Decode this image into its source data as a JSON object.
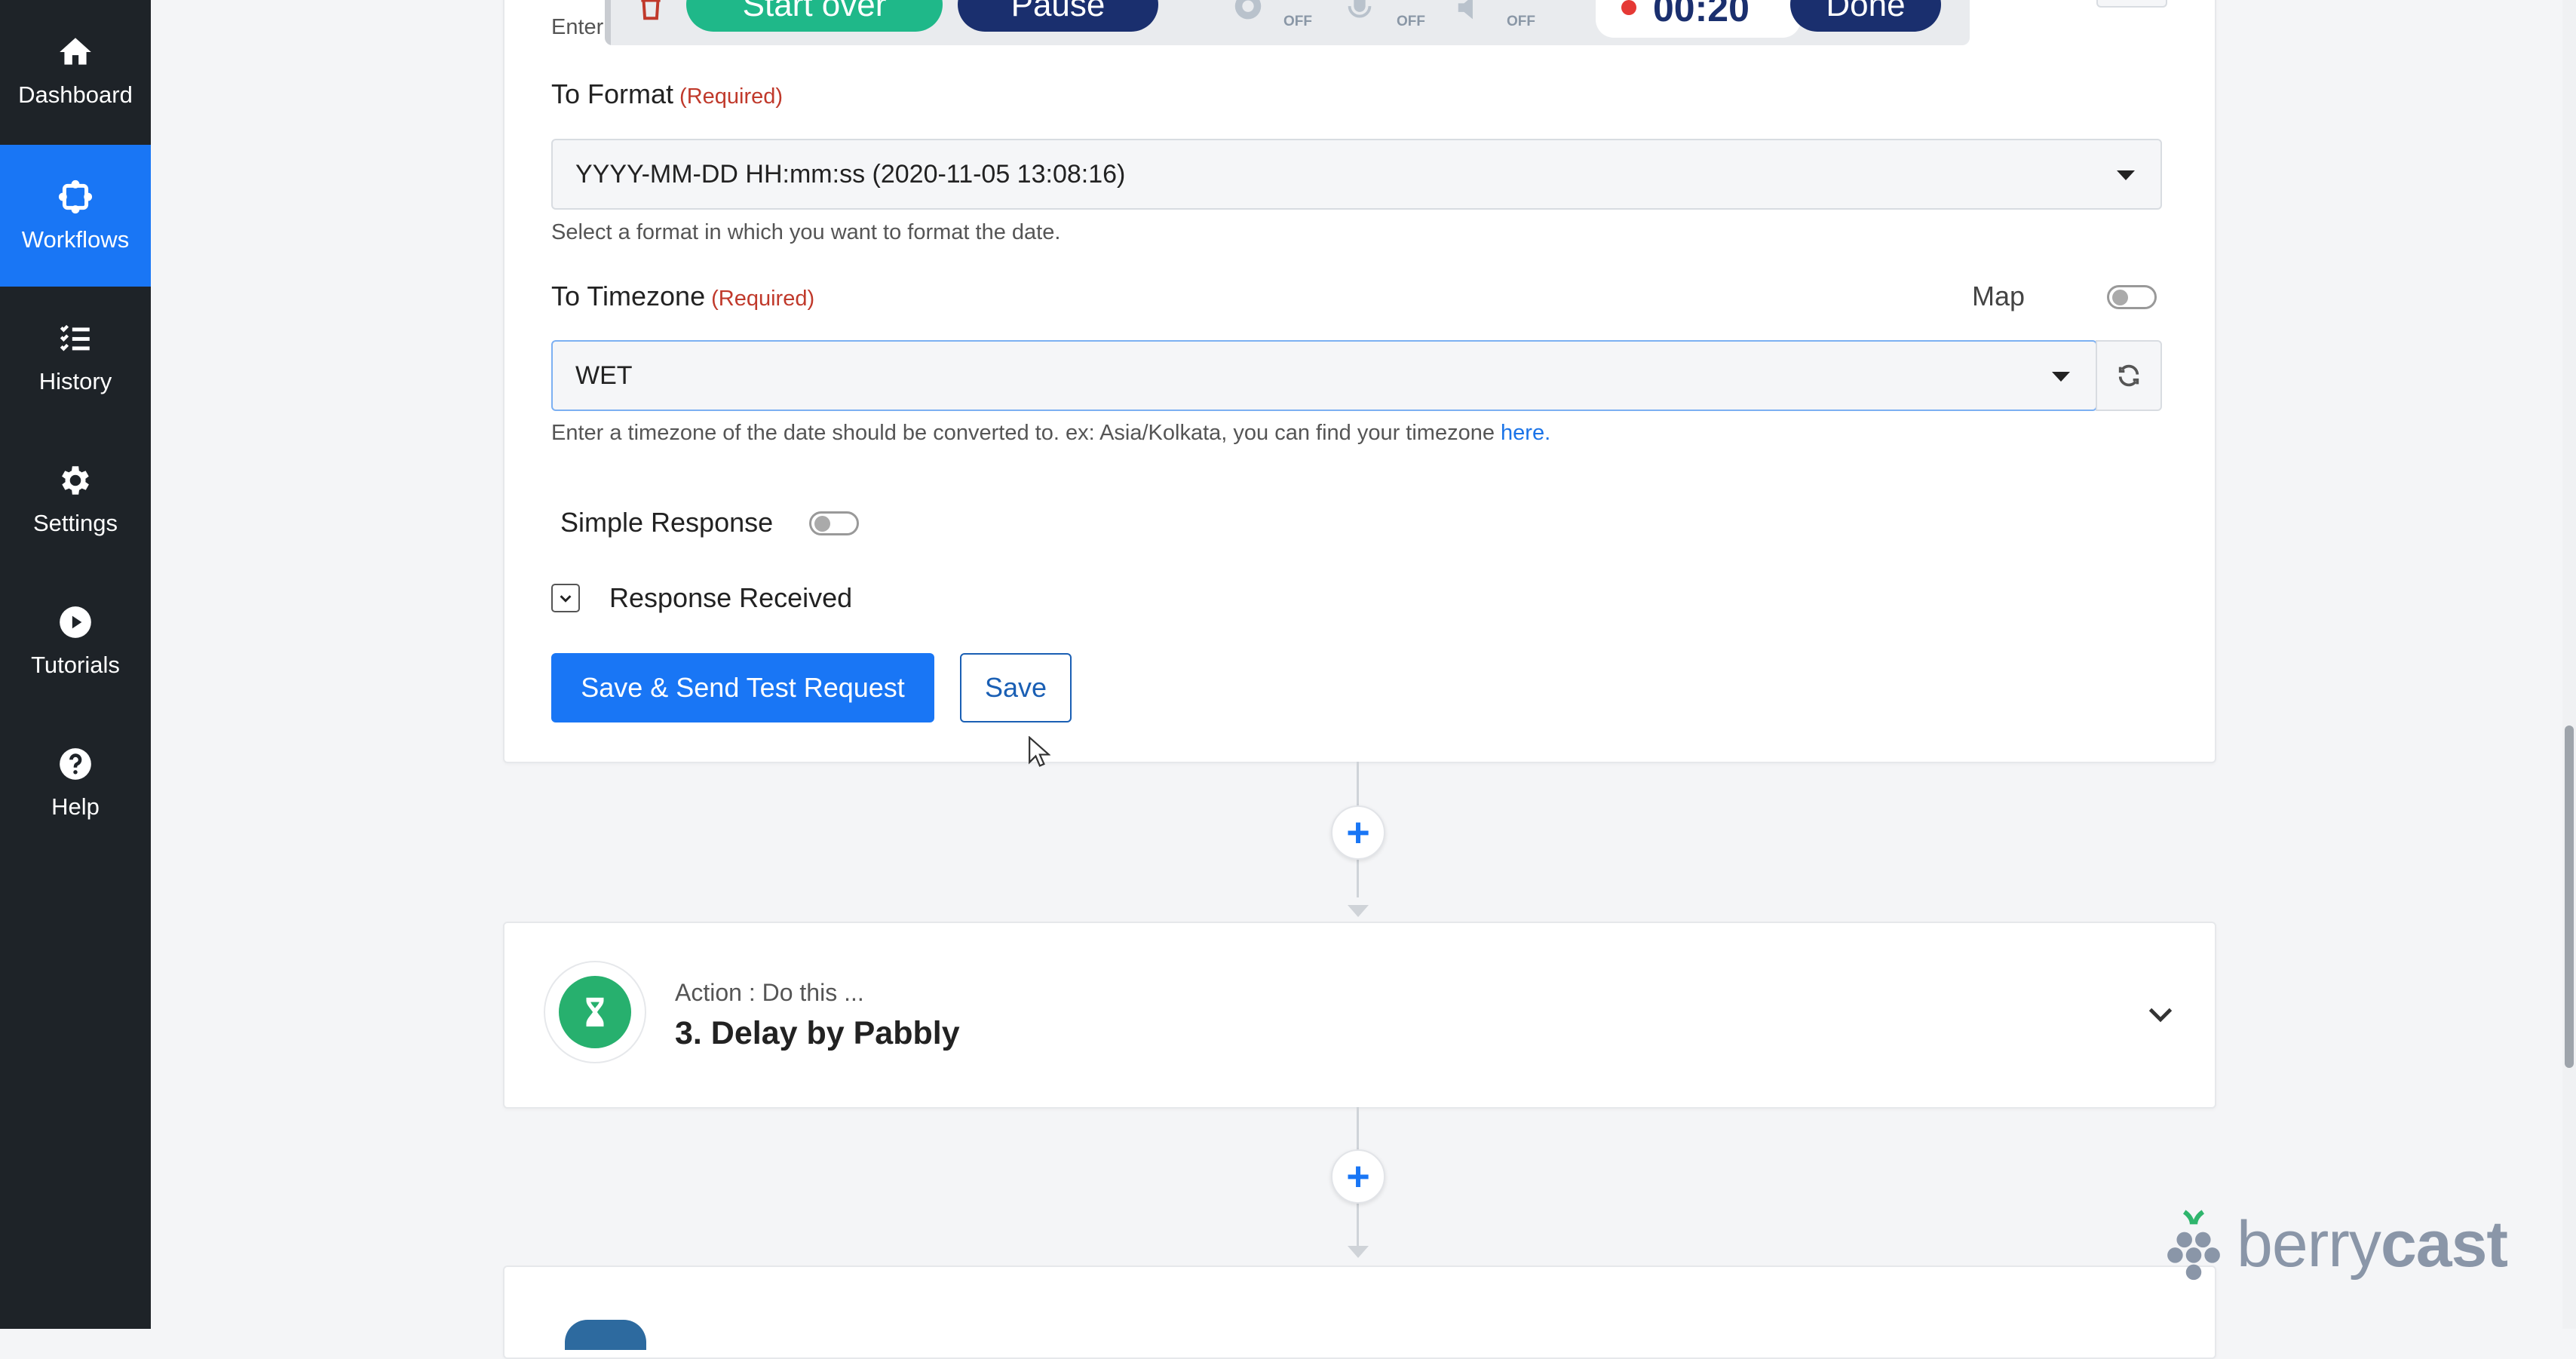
{
  "sidebar": {
    "items": [
      {
        "label": "Dashboard",
        "icon": "home-icon"
      },
      {
        "label": "Workflows",
        "icon": "workflow-icon",
        "active": true
      },
      {
        "label": "History",
        "icon": "list-check-icon"
      },
      {
        "label": "Settings",
        "icon": "gear-icon"
      },
      {
        "label": "Tutorials",
        "icon": "play-circle-icon"
      },
      {
        "label": "Help",
        "icon": "help-circle-icon"
      }
    ]
  },
  "recorder": {
    "start_over": "Start over",
    "pause": "Pause",
    "off": "OFF",
    "timer": "00:20",
    "done": "Done"
  },
  "form": {
    "top_hint": "Enter",
    "to_format": {
      "label": "To Format",
      "required": "(Required)",
      "value": "YYYY-MM-DD HH:mm:ss (2020-11-05 13:08:16)",
      "help": "Select a format in which you want to format the date."
    },
    "to_timezone": {
      "label": "To Timezone",
      "required": "(Required)",
      "map_label": "Map",
      "value": "WET",
      "help": "Enter a timezone of the date should be converted to. ex: Asia/Kolkata, you can find your timezone ",
      "help_link": "here."
    },
    "simple_response": "Simple Response",
    "response_received": "Response Received",
    "save_send": "Save & Send Test Request",
    "save": "Save"
  },
  "action_step": {
    "subtitle": "Action : Do this ...",
    "title": "3. Delay by Pabbly",
    "icon": "hourglass-icon",
    "icon_color": "#27b06e"
  },
  "watermark": {
    "brand_light": "berry",
    "brand_bold": "cast"
  },
  "colors": {
    "primary": "#1976f5",
    "sidebar_bg": "#1e2328",
    "required": "#c0392b",
    "recorder_green": "#1fb889",
    "recorder_navy": "#1a2f6e"
  }
}
